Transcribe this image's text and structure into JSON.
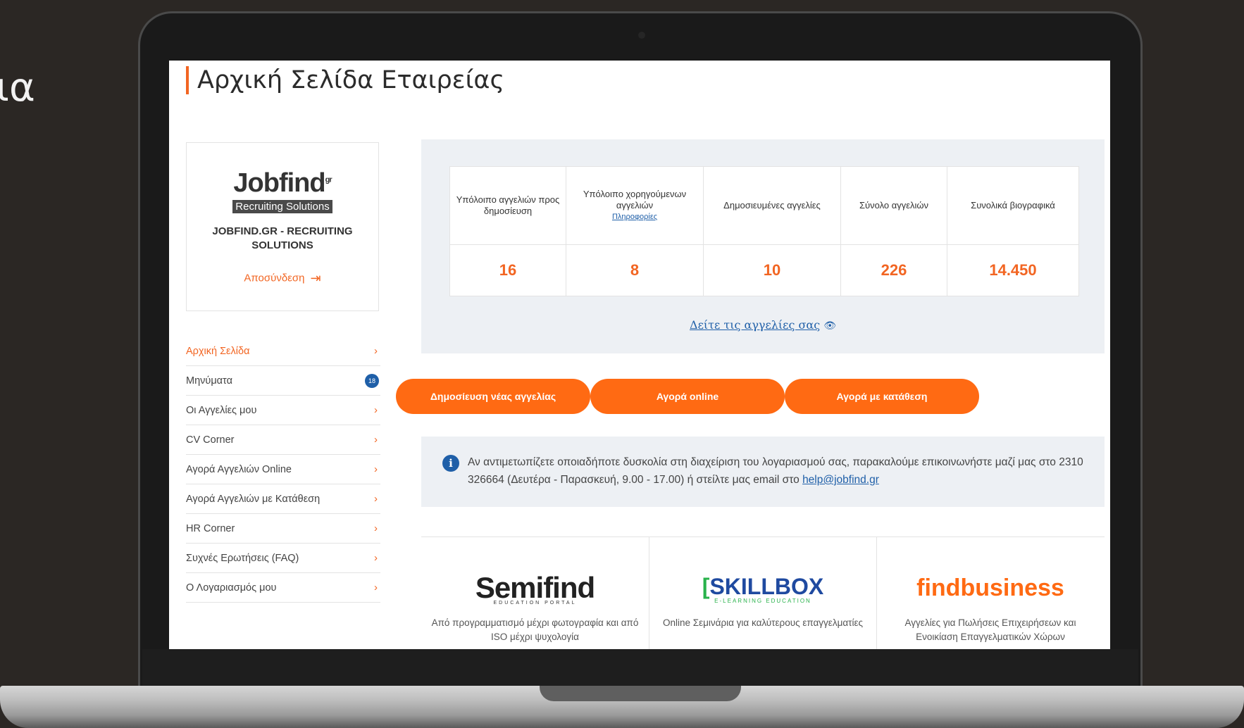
{
  "background_text": "ια",
  "page": {
    "title": "Αρχική Σελίδα Εταιρείας"
  },
  "company": {
    "logo_text": "Jobfind",
    "logo_sup": "gr",
    "logo_tagline": "Recruiting Solutions",
    "name": "JOBFIND.GR - RECRUITING SOLUTIONS",
    "logout_label": "Αποσύνδεση",
    "logout_icon": "logout-arrow-icon"
  },
  "sidebar": {
    "items": [
      {
        "label": "Αρχική Σελίδα",
        "active": true
      },
      {
        "label": "Μηνύματα",
        "badge": "18"
      },
      {
        "label": "Οι Αγγελίες μου"
      },
      {
        "label": "CV Corner"
      },
      {
        "label": "Αγορά Αγγελιών Online"
      },
      {
        "label": "Αγορά Αγγελιών με Κατάθεση"
      },
      {
        "label": "HR Corner"
      },
      {
        "label": "Συχνές Ερωτήσεις (FAQ)"
      },
      {
        "label": "Ο Λογαριασμός μου"
      }
    ]
  },
  "stats": {
    "headers": [
      "Υπόλοιπο αγγελιών προς δημοσίευση",
      "Υπόλοιπο χορηγούμενων αγγελιών",
      "Δημοσιευμένες αγγελίες",
      "Σύνολο αγγελιών",
      "Συνολικά βιογραφικά"
    ],
    "info_link": "Πληροφορίες",
    "values": [
      "16",
      "8",
      "10",
      "226",
      "14.450"
    ],
    "view_link": "Δείτε τις αγγελίες σας"
  },
  "actions": {
    "publish": "Δημοσίευση νέας αγγελίας",
    "buy_online": "Αγορά online",
    "buy_deposit": "Αγορά με κατάθεση"
  },
  "info": {
    "text": "Αν αντιμετωπίζετε οποιαδήποτε δυσκολία στη διαχείριση του λογαριασμού σας, παρακαλούμε επικοινωνήστε μαζί μας στο 2310 326664 (Δευτέρα - Παρασκευή, 9.00 - 17.00) ή στείλτε μας email στο ",
    "email": "help@jobfind.gr"
  },
  "partners": [
    {
      "name": "Semifind",
      "sub": "EDUCATION PORTAL",
      "desc": "Από προγραμματισμό μέχρι φωτογραφία και από ISO μέχρι ψυχολογία"
    },
    {
      "name": "SKILLBOX",
      "sub": "E-LEARNING EDUCATION",
      "desc": "Online Σεμινάρια για καλύτερους επαγγελματίες"
    },
    {
      "name": "findbusiness",
      "desc": "Αγγελίες για Πωλήσεις Επιχειρήσεων και Ενοικίαση Επαγγελματικών Χώρων"
    }
  ],
  "colors": {
    "accent": "#f26522",
    "button": "#ff6a13",
    "link": "#1f5fa8",
    "panel": "#edf0f4"
  }
}
